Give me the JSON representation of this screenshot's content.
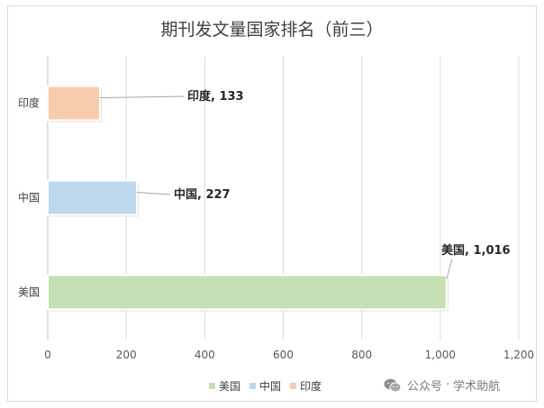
{
  "chart_data": {
    "type": "bar",
    "orientation": "horizontal",
    "title": "期刊发文量国家排名（前三）",
    "categories": [
      "美国",
      "中国",
      "印度"
    ],
    "values": [
      1016,
      227,
      133
    ],
    "colors": [
      "#c6e0b4",
      "#bdd7ee",
      "#f8cbad"
    ],
    "data_labels": [
      "美国, 1,016",
      "中国, 227",
      "印度, 133"
    ],
    "xlim": [
      0,
      1200
    ],
    "x_ticks": [
      "0",
      "200",
      "400",
      "600",
      "800",
      "1,000",
      "1,200"
    ],
    "grid": true,
    "legend": [
      "美国",
      "中国",
      "印度"
    ],
    "legend_position": "bottom"
  },
  "watermark": {
    "icon": "wechat-icon",
    "account": "公众号",
    "separator": "·",
    "name": "学术助航"
  }
}
